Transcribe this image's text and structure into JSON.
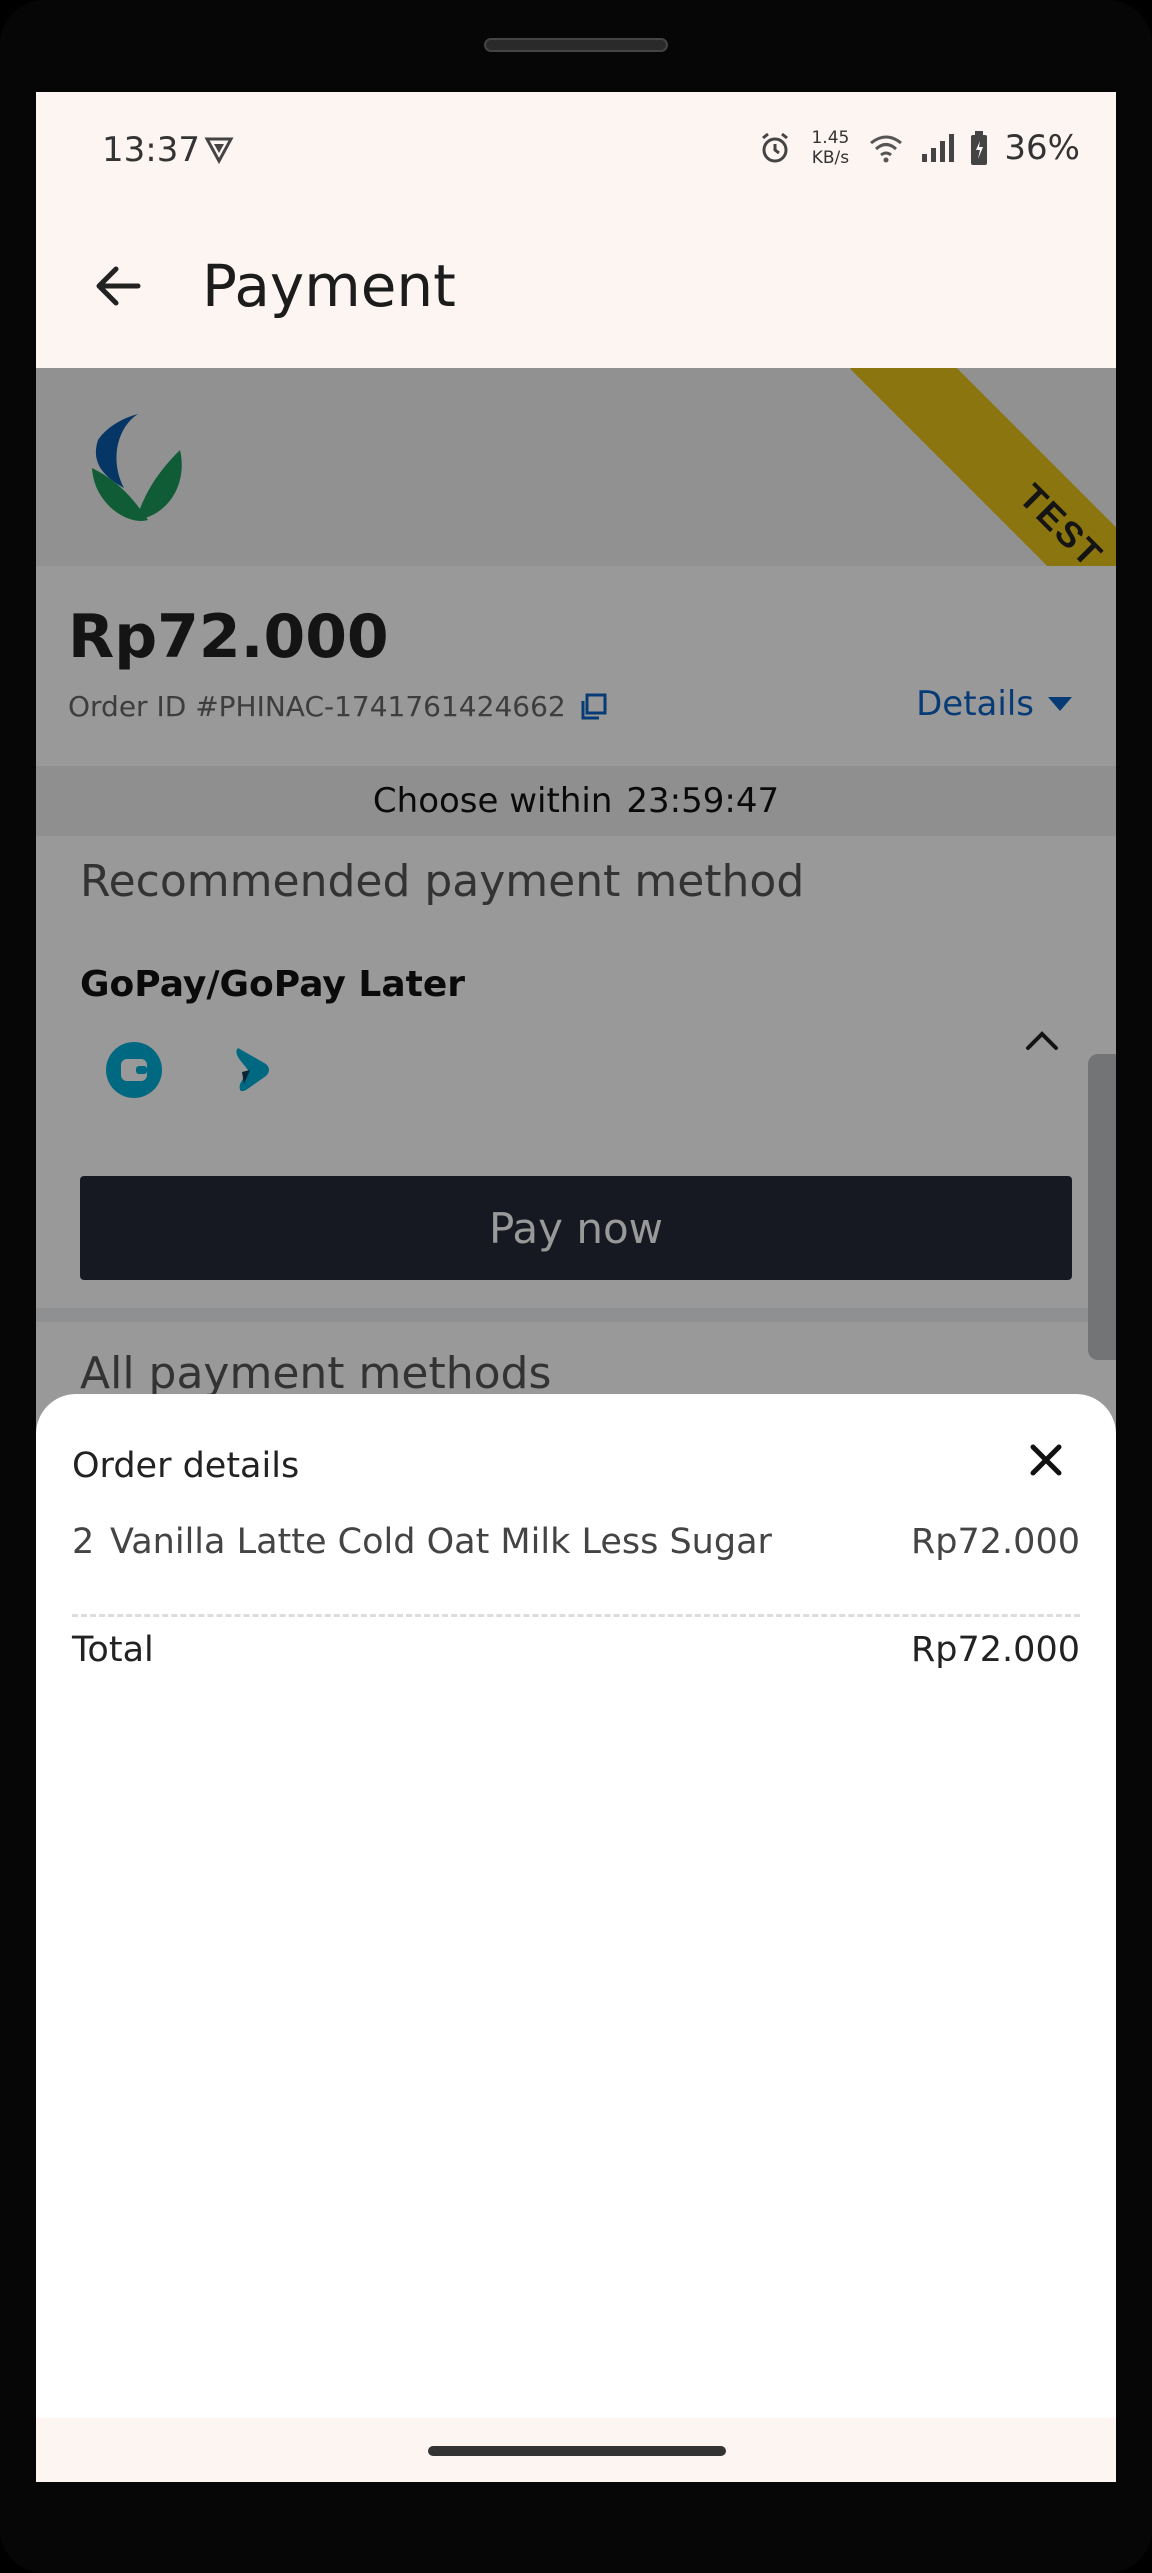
{
  "status_bar": {
    "time": "13:37",
    "net_speed_value": "1.45",
    "net_speed_unit": "KB/s",
    "battery": "36%"
  },
  "app_bar": {
    "title": "Payment"
  },
  "merchant": {
    "ribbon_text": "TEST"
  },
  "order": {
    "amount": "Rp72.000",
    "order_id": "Order ID #PHINAC-1741761424662",
    "details_label": "Details"
  },
  "timer": {
    "label": "Choose within",
    "value": "23:59:47"
  },
  "payment": {
    "recommended_title": "Recommended payment method",
    "method_name": "GoPay/GoPay Later",
    "pay_now_label": "Pay now",
    "all_methods_title": "All payment methods"
  },
  "sheet": {
    "title": "Order details",
    "items": [
      {
        "qty": "2",
        "name": "Vanilla Latte Cold Oat Milk Less Sugar",
        "price": "Rp72.000"
      }
    ],
    "total_label": "Total",
    "total_value": "Rp72.000"
  },
  "colors": {
    "accent_blue": "#0b63c3",
    "ribbon_yellow": "#e8c31a",
    "button_dark": "#252b38",
    "gopay_teal": "#00aed6"
  }
}
